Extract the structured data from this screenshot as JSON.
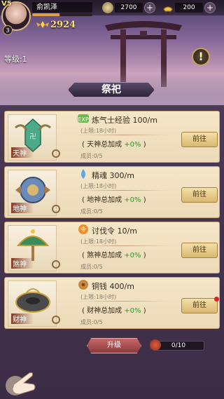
{
  "player": {
    "vip": "V5",
    "level_badge": "3",
    "name": "俞凯泽",
    "exp_fraction": 0.45,
    "power": "2924"
  },
  "resources": [
    {
      "icon": "coin-icon",
      "value": "2700"
    },
    {
      "icon": "gold-ingot-icon",
      "value": "200"
    }
  ],
  "header": {
    "level_label": "等级:1",
    "info_glyph": "!",
    "sacrifice_button": "祭祀"
  },
  "cards": [
    {
      "god": "天神",
      "resource_icon": "exp-icon",
      "resource": "炼气士经验 100/m",
      "limit": "(上限:18小时)",
      "bonus_prefix": "( 天神总加成 ",
      "bonus_value": "+0%",
      "bonus_suffix": " )",
      "members": "成员:0/5",
      "button": "前往",
      "has_red_dot": false
    },
    {
      "god": "地神",
      "resource_icon": "soul-drop-icon",
      "resource": "精魂 300/m",
      "limit": "(上限:18小时)",
      "bonus_prefix": "( 地神总加成 ",
      "bonus_value": "+0%",
      "bonus_suffix": " )",
      "members": "成员:0/5",
      "button": "前往",
      "has_red_dot": false
    },
    {
      "god": "煞神",
      "resource_icon": "crusade-token-icon",
      "resource": "讨伐令 10/m",
      "limit": "(上限:18小时)",
      "bonus_prefix": "( 煞神总加成 ",
      "bonus_value": "+0%",
      "bonus_suffix": " )",
      "members": "成员:0/5",
      "button": "前往",
      "has_red_dot": false
    },
    {
      "god": "财神",
      "resource_icon": "copper-coin-icon",
      "resource": "铜钱 400/m",
      "limit": "(上限:18小时)",
      "bonus_prefix": "( 财神总加成 ",
      "bonus_value": "+0%",
      "bonus_suffix": " )",
      "members": "成员:0/5",
      "button": "前往",
      "has_red_dot": true
    }
  ],
  "footer": {
    "upgrade_button": "升级",
    "progress": "0/10"
  },
  "colors": {
    "bonus_green": "#2a9a2a",
    "accent_gold": "#ffe070"
  }
}
